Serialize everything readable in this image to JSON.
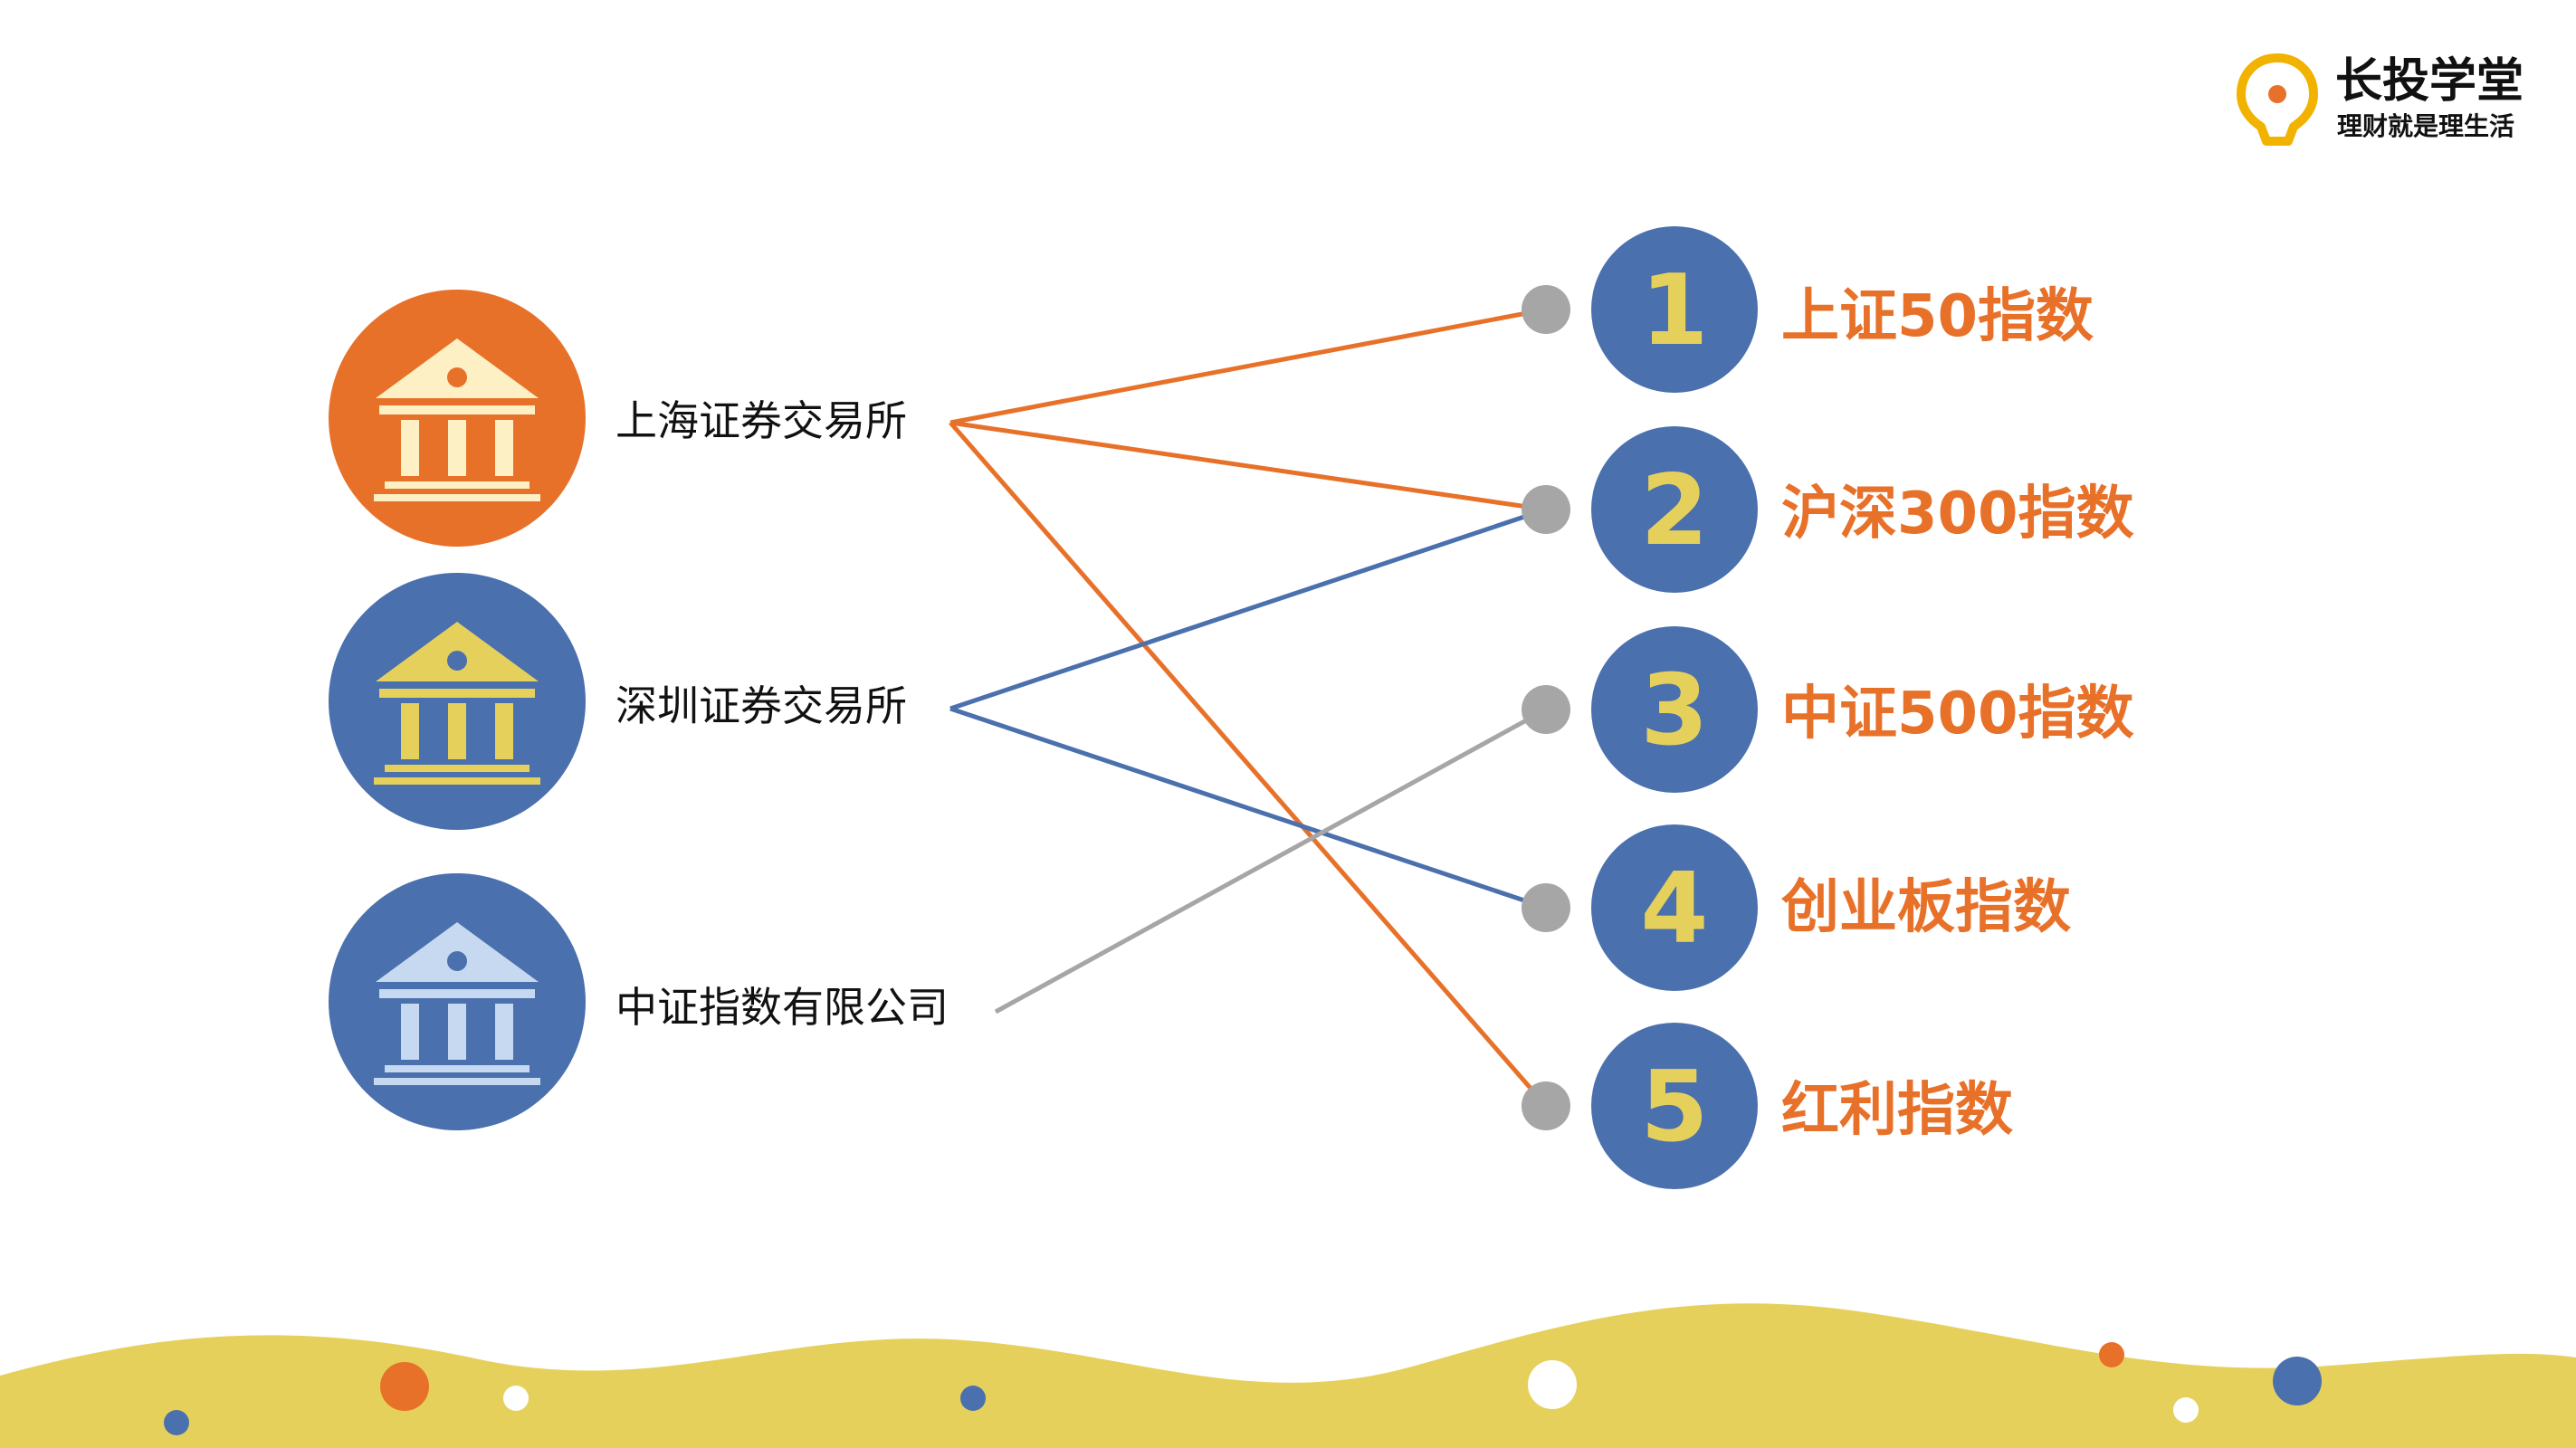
{
  "brand": {
    "name": "长投学堂",
    "slogan": "理财就是理生活",
    "accent": "#f2b200"
  },
  "colors": {
    "orange": "#e8712a",
    "blue": "#4a70ad",
    "gray": "#a6a6a6",
    "yellow": "#e6d05c",
    "text_dark": "#111111"
  },
  "institutions": [
    {
      "name": "上海证券交易所",
      "icon": "bank-building-icon",
      "circle_color": "#e8712a",
      "icon_color": "#fdf0c4"
    },
    {
      "name": "深圳证券交易所",
      "icon": "bank-building-icon",
      "circle_color": "#4a70ad",
      "icon_color": "#e6d05c"
    },
    {
      "name": "中证指数有限公司",
      "icon": "bank-building-icon",
      "circle_color": "#4a70ad",
      "icon_color": "#c6d9f1"
    }
  ],
  "indices": [
    {
      "number": "1",
      "name": "上证50指数"
    },
    {
      "number": "2",
      "name": "沪深300指数"
    },
    {
      "number": "3",
      "name": "中证500指数"
    },
    {
      "number": "4",
      "name": "创业板指数"
    },
    {
      "number": "5",
      "name": "红利指数"
    }
  ],
  "connections": [
    {
      "from": "上海证券交易所",
      "to": "1",
      "color": "#e8712a"
    },
    {
      "from": "上海证券交易所",
      "to": "2",
      "color": "#e8712a"
    },
    {
      "from": "上海证券交易所",
      "to": "5",
      "color": "#e8712a"
    },
    {
      "from": "深圳证券交易所",
      "to": "2",
      "color": "#4a70ad"
    },
    {
      "from": "深圳证券交易所",
      "to": "4",
      "color": "#4a70ad"
    },
    {
      "from": "中证指数有限公司",
      "to": "3",
      "color": "#a6a6a6"
    }
  ]
}
